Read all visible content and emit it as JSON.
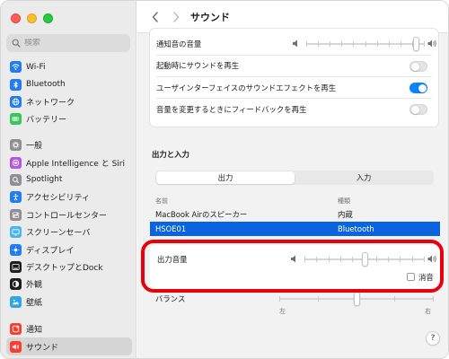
{
  "window": {
    "title": "サウンド",
    "accent_color": "#0a84ff",
    "selection_color": "#0a64e0",
    "highlight_color": "#e8000b"
  },
  "sidebar": {
    "search_placeholder": "検索",
    "groups": [
      [
        {
          "label": "Wi-Fi",
          "icon": "wifi-icon",
          "color": "#1f7cf3"
        },
        {
          "label": "Bluetooth",
          "icon": "bluetooth-icon",
          "color": "#1f7cf3"
        },
        {
          "label": "ネットワーク",
          "icon": "globe-icon",
          "color": "#1f7cf3"
        },
        {
          "label": "バッテリー",
          "icon": "battery-icon",
          "color": "#34c759"
        }
      ],
      [
        {
          "label": "一般",
          "icon": "gear-icon",
          "color": "#8e8e93"
        },
        {
          "label": "Apple Intelligence と Siri",
          "icon": "siri-icon",
          "color": "#b455e0"
        },
        {
          "label": "Spotlight",
          "icon": "spotlight-icon",
          "color": "#8e8e93"
        },
        {
          "label": "アクセシビリティ",
          "icon": "accessibility-icon",
          "color": "#1f7cf3"
        },
        {
          "label": "コントロールセンター",
          "icon": "control-center-icon",
          "color": "#8e8e93"
        },
        {
          "label": "スクリーンセーバ",
          "icon": "screensaver-icon",
          "color": "#4ab4f0"
        },
        {
          "label": "ディスプレイ",
          "icon": "display-icon",
          "color": "#1f7cf3"
        },
        {
          "label": "デスクトップとDock",
          "icon": "dock-icon",
          "color": "#1d1d1f"
        },
        {
          "label": "外観",
          "icon": "appearance-icon",
          "color": "#1d1d1f"
        },
        {
          "label": "壁紙",
          "icon": "wallpaper-icon",
          "color": "#2fa4e7"
        }
      ],
      [
        {
          "label": "通知",
          "icon": "notification-icon",
          "color": "#ff3b30"
        },
        {
          "label": "サウンド",
          "icon": "sound-icon",
          "color": "#ff3b30",
          "selected": true
        }
      ]
    ]
  },
  "effects": {
    "alert_volume_label": "通知音の音量",
    "alert_volume_level": 0.95,
    "startup_sound_label": "起動時にサウンドを再生",
    "startup_sound_on": false,
    "ui_effects_label": "ユーザインターフェイスのサウンドエフェクトを再生",
    "ui_effects_on": true,
    "volume_feedback_label": "音量を変更するときにフィードバックを再生",
    "volume_feedback_on": false
  },
  "io": {
    "section_title": "出力と入力",
    "tabs": [
      "出力",
      "入力"
    ],
    "active_tab": 0,
    "columns": [
      "名前",
      "種類"
    ],
    "devices": [
      {
        "name": "MacBook Airのスピーカー",
        "type": "内蔵",
        "selected": false
      },
      {
        "name": "HSOE01",
        "type": "Bluetooth",
        "selected": true
      }
    ]
  },
  "output": {
    "volume_label": "出力音量",
    "volume_level": 0.5,
    "mute_label": "消音",
    "muted": false,
    "balance_label": "バランス",
    "balance_left": "左",
    "balance_right": "右",
    "balance_level": 0.5
  },
  "help_label": "?"
}
